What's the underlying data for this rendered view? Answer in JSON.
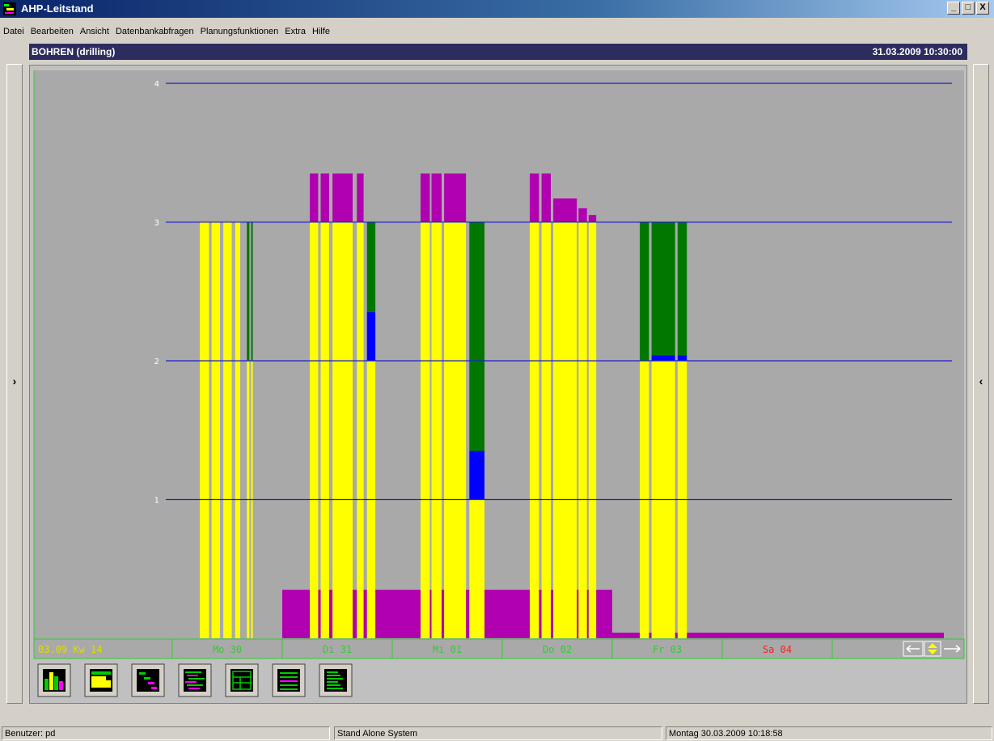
{
  "window": {
    "title": "AHP-Leitstand",
    "controls": [
      "_",
      "□",
      "X"
    ]
  },
  "menu": [
    "Datei",
    "Bearbeiten",
    "Ansicht",
    "Datenbankabfragen",
    "Planungsfunktionen",
    "Extra",
    "Hilfe"
  ],
  "header": {
    "left": "BOHREN  (drilling)",
    "right": "31.03.2009 10:30:00"
  },
  "rails": {
    "left_arrow": "›",
    "right_arrow": "‹"
  },
  "colors": {
    "chart_bg": "#a9a9a9",
    "gridline": "#1e1ecf",
    "yellow": "#ffff00",
    "green": "#007800",
    "blue": "#0000ff",
    "magenta": "#b000b0",
    "axis_green": "#33cc33",
    "week_label": "#dddd00",
    "saturday_label": "#ff2020",
    "toolbar_bg": "#c0c0c0"
  },
  "chart_data": {
    "type": "bar",
    "title": "BOHREN  (drilling)",
    "ylim": [
      0,
      4
    ],
    "yticks": [
      "1",
      "2",
      "3",
      "4"
    ],
    "grid": true,
    "week_label": "03.09 Kw 14",
    "days": [
      "Mo 30",
      "Di 31",
      "Mi 01",
      "Do 02",
      "Fr 03",
      "Sa 04"
    ],
    "series_colors": {
      "planned_load": "yellow",
      "secondary_load": "green",
      "blue_load": "blue",
      "overload_capacity_band": "magenta"
    },
    "day_groups": [
      {
        "day": "Mo 30",
        "stacks": [
          {
            "x": 0.0,
            "w": 0.11,
            "yellow": 3.0
          },
          {
            "x": 0.14,
            "w": 0.1,
            "yellow": 3.0
          },
          {
            "x": 0.28,
            "w": 0.1,
            "yellow": 3.0
          },
          {
            "x": 0.42,
            "w": 0.06,
            "yellow": 3.0
          },
          {
            "x": 0.56,
            "w": 0.03,
            "yellow": 2.0,
            "green": 1.0
          },
          {
            "x": 0.61,
            "w": 0.02,
            "yellow": 2.0,
            "green": 1.0
          }
        ]
      },
      {
        "day": "Di 31",
        "stacks": [
          {
            "x": 0.0,
            "w": 0.1,
            "yellow": 3.0,
            "magenta": 0.35
          },
          {
            "x": 0.13,
            "w": 0.1,
            "yellow": 3.0,
            "magenta": 0.35
          },
          {
            "x": 0.27,
            "w": 0.24,
            "yellow": 3.0,
            "magenta": 0.35
          },
          {
            "x": 0.56,
            "w": 0.08,
            "yellow": 3.0,
            "magenta": 0.35
          },
          {
            "x": 0.68,
            "w": 0.1,
            "yellow": 2.0,
            "blue": 0.35,
            "green": 0.65
          }
        ]
      },
      {
        "day": "Mi 01",
        "stacks": [
          {
            "x": 0.0,
            "w": 0.11,
            "yellow": 3.0,
            "magenta": 0.35
          },
          {
            "x": 0.13,
            "w": 0.12,
            "yellow": 3.0,
            "magenta": 0.35
          },
          {
            "x": 0.28,
            "w": 0.26,
            "yellow": 3.0,
            "magenta": 0.35
          },
          {
            "x": 0.58,
            "w": 0.18,
            "yellow": 1.0,
            "blue": 0.35,
            "green": 1.65
          }
        ]
      },
      {
        "day": "Do 02",
        "stacks": [
          {
            "x": 0.0,
            "w": 0.11,
            "yellow": 3.0,
            "magenta": 0.35
          },
          {
            "x": 0.14,
            "w": 0.11,
            "yellow": 3.0,
            "magenta": 0.35
          },
          {
            "x": 0.28,
            "w": 0.28,
            "yellow": 3.0,
            "magenta": 0.17
          },
          {
            "x": 0.58,
            "w": 0.1,
            "yellow": 3.0,
            "magenta": 0.1
          },
          {
            "x": 0.7,
            "w": 0.09,
            "yellow": 3.0,
            "magenta": 0.05
          }
        ]
      },
      {
        "day": "Fr 03",
        "stacks": [
          {
            "x": 0.0,
            "w": 0.11,
            "yellow": 2.0,
            "green": 1.0
          },
          {
            "x": 0.14,
            "w": 0.28,
            "yellow": 2.0,
            "blue": 0.04,
            "green": 0.96
          },
          {
            "x": 0.45,
            "w": 0.11,
            "yellow": 2.0,
            "blue": 0.04,
            "green": 0.96
          }
        ]
      },
      {
        "day": "Sa 04",
        "stacks": []
      }
    ],
    "base_band": [
      {
        "from": "Mo 30",
        "level": 0.0
      },
      {
        "from": "Di 31",
        "level": 0.35
      },
      {
        "from": "Mi 01",
        "level": 0.35
      },
      {
        "from": "Do 02",
        "level": 0.35
      },
      {
        "from": "Fr 03",
        "level": 0.04
      },
      {
        "from": "Sa 04",
        "level": 0.04
      }
    ]
  },
  "toolbar": {
    "buttons": [
      "bar-chart-icon",
      "yellow-load-icon",
      "staircase-icon",
      "gantt-list-icon",
      "grid-table-icon",
      "hatch-lines-icon",
      "text-lines-icon"
    ]
  },
  "status": {
    "user": "Benutzer: pd",
    "system": "Stand Alone System",
    "datetime": "Montag 30.03.2009 10:18:58"
  }
}
